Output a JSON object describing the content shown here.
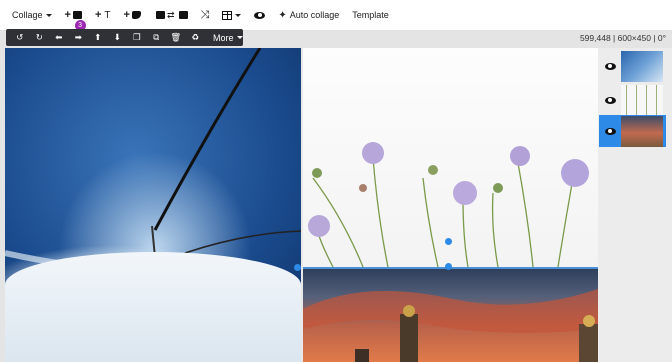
{
  "toolbar": {
    "collage_label": "Collage",
    "add_image_badge": "3",
    "add_text_label": "T",
    "auto_collage_label": "Auto collage",
    "template_label": "Template"
  },
  "selection_toolbar": {
    "more_label": "More",
    "icons": [
      "rotate-left-icon",
      "rotate-right-icon",
      "arrow-left-icon",
      "arrow-right-icon",
      "arrow-up-icon",
      "arrow-down-icon",
      "bring-front-icon",
      "send-back-icon",
      "delete-icon",
      "recycle-icon"
    ]
  },
  "status": {
    "text": "599,448 | 600×450 | 0°"
  },
  "layers": [
    {
      "name": "ski-lift",
      "active": false
    },
    {
      "name": "flowers",
      "active": false
    },
    {
      "name": "paris-bridge",
      "active": true
    }
  ],
  "colors": {
    "accent": "#2d8ae6",
    "badge": "#9c27b0",
    "dark_toolbar": "#2f3136"
  }
}
